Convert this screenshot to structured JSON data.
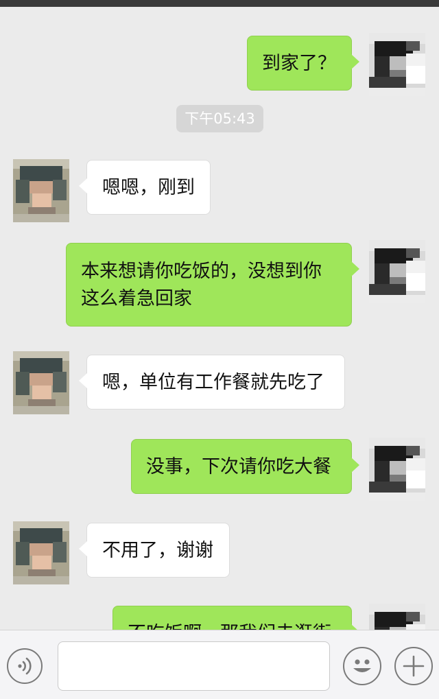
{
  "chat": {
    "timestamp": "下午05:43",
    "messages": [
      {
        "sender": "me",
        "text": "到家了？"
      },
      {
        "sender": "them",
        "text": "嗯嗯，刚到"
      },
      {
        "sender": "me",
        "text": "本来想请你吃饭的，没想到你\n这么着急回家"
      },
      {
        "sender": "them",
        "text": "嗯，单位有工作餐就先吃了"
      },
      {
        "sender": "me",
        "text": "没事，下次请你吃大餐"
      },
      {
        "sender": "them",
        "text": "不用了，谢谢"
      },
      {
        "sender": "me",
        "text": "不吃饭啊，那我们去逛街"
      }
    ]
  },
  "input_bar": {
    "voice_icon": "voice-icon",
    "emoji_icon": "emoji-icon",
    "plus_icon": "plus-icon",
    "input_value": ""
  },
  "colors": {
    "background": "#ebebeb",
    "my_bubble": "#9fe65a",
    "their_bubble": "#ffffff",
    "timestamp_bg": "#d6d6d6",
    "top_strip": "#3a3a3a"
  }
}
